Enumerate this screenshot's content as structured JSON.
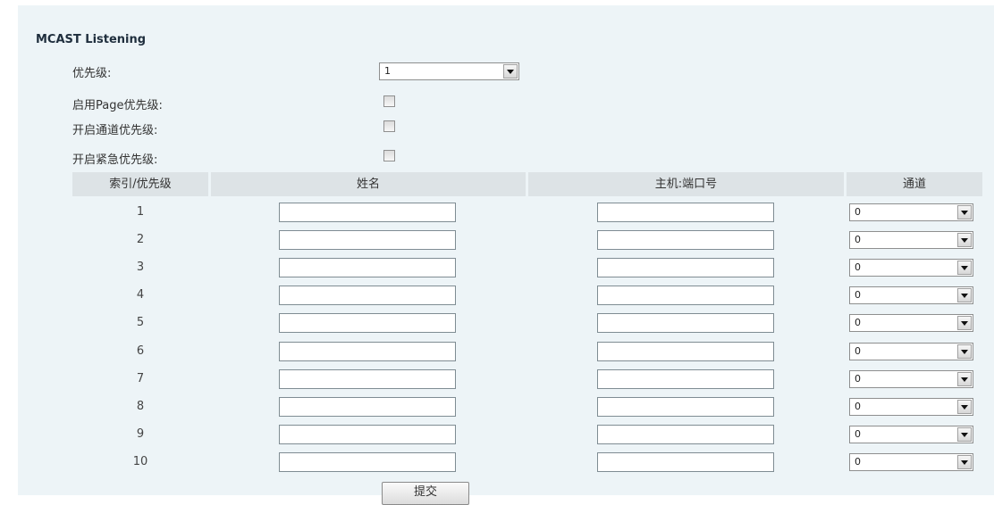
{
  "section_title": "MCAST Listening",
  "options": {
    "priority": {
      "label": "优先级:",
      "value": "1"
    },
    "enable_page_priority": {
      "label": "启用Page优先级:",
      "checked": false
    },
    "enable_channel_priority": {
      "label": "开启通道优先级:",
      "checked": false
    },
    "enable_emergency_priority": {
      "label": "开启紧急优先级:",
      "checked": false
    }
  },
  "table": {
    "headers": [
      "索引/优先级",
      "姓名",
      "主机:端口号",
      "通道"
    ],
    "rows": [
      {
        "index": "1",
        "name": "",
        "host_port": "",
        "channel": "0"
      },
      {
        "index": "2",
        "name": "",
        "host_port": "",
        "channel": "0"
      },
      {
        "index": "3",
        "name": "",
        "host_port": "",
        "channel": "0"
      },
      {
        "index": "4",
        "name": "",
        "host_port": "",
        "channel": "0"
      },
      {
        "index": "5",
        "name": "",
        "host_port": "",
        "channel": "0"
      },
      {
        "index": "6",
        "name": "",
        "host_port": "",
        "channel": "0"
      },
      {
        "index": "7",
        "name": "",
        "host_port": "",
        "channel": "0"
      },
      {
        "index": "8",
        "name": "",
        "host_port": "",
        "channel": "0"
      },
      {
        "index": "9",
        "name": "",
        "host_port": "",
        "channel": "0"
      },
      {
        "index": "10",
        "name": "",
        "host_port": "",
        "channel": "0"
      }
    ]
  },
  "submit_label": "提交",
  "colors": {
    "panel_background": "#edf4f7",
    "header_background": "#dde3e6",
    "title_text": "#1f2e3d"
  }
}
